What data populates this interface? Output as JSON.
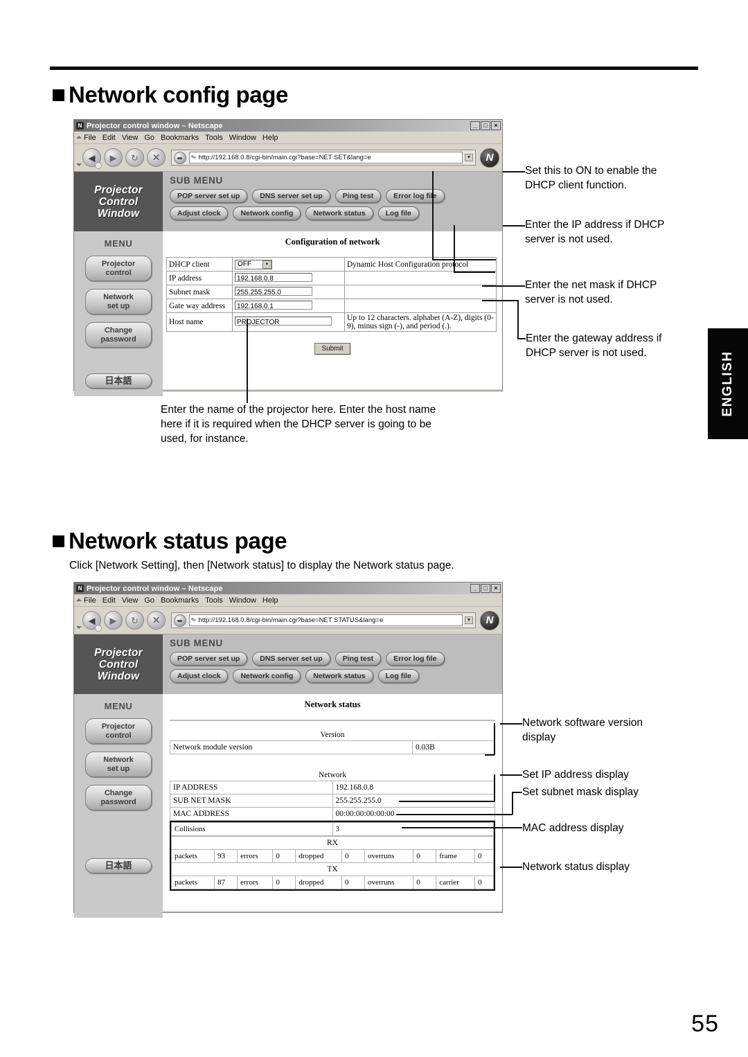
{
  "page": {
    "number": "55",
    "side_tab": "ENGLISH"
  },
  "sections": {
    "config": {
      "heading": "Network config page"
    },
    "status": {
      "heading": "Network status page",
      "intro": "Click [Network Setting], then [Network status] to display the Network status page."
    }
  },
  "browser_chrome": {
    "title": "Projector control window  –  Netscape",
    "title_icon": "netscape-icon",
    "menu_items": [
      "File",
      "Edit",
      "View",
      "Go",
      "Bookmarks",
      "Tools",
      "Window",
      "Help"
    ],
    "window_buttons": [
      "minimize",
      "maximize",
      "close"
    ],
    "nav_buttons": [
      "back",
      "forward",
      "reload",
      "stop"
    ],
    "logo": "N"
  },
  "window_config": {
    "url": "http://192.168.0.8/cgi-bin/main.cgi?base=NET SET&lang=e"
  },
  "window_status": {
    "url": "http://192.168.0.8/cgi-bin/main.cgi?base=NET STATUS&lang=e"
  },
  "app": {
    "brand": [
      "Projector",
      "Control",
      "Window"
    ],
    "menu_label": "MENU",
    "menu_items": [
      {
        "line1": "Projector",
        "line2": "control"
      },
      {
        "line1": "Network",
        "line2": "set up"
      },
      {
        "line1": "Change",
        "line2": "password"
      }
    ],
    "language_button": "日本語",
    "submenu_label": "SUB MENU",
    "submenu_row1": [
      "POP server set up",
      "DNS server set up",
      "Ping test",
      "Error log file"
    ],
    "submenu_row2": [
      "Adjust clock",
      "Network config",
      "Network status",
      "Log file"
    ]
  },
  "config_page": {
    "title": "Configuration of network",
    "rows": [
      {
        "label": "DHCP client",
        "control": "select",
        "value": "OFF",
        "note": "Dynamic Host Configuration protocol"
      },
      {
        "label": "IP address",
        "control": "text",
        "value": "192.168.0.8",
        "note": ""
      },
      {
        "label": "Subnet mask",
        "control": "text",
        "value": "255.255.255.0",
        "note": ""
      },
      {
        "label": "Gate way address",
        "control": "text",
        "value": "192.168.0.1",
        "note": ""
      },
      {
        "label": "Host name",
        "control": "text",
        "value": "PROJECTOR",
        "note": "Up to 12 characters. alphabet (A-Z), digits (0-9), minus sign (-), and period (.)."
      }
    ],
    "submit_label": "Submit"
  },
  "status_page": {
    "title": "Network status",
    "version_group": "Version",
    "version_row": {
      "label": "Network module version",
      "value": "0.03B"
    },
    "network_group": "Network",
    "network_rows": [
      {
        "label": "IP ADDRESS",
        "value": "192.168.0.8"
      },
      {
        "label": "SUB NET MASK",
        "value": "255.255.255.0"
      },
      {
        "label": "MAC ADDRESS",
        "value": "00:00:00:00:00:00"
      }
    ],
    "collisions": {
      "label": "Collisions",
      "value": "3"
    },
    "rx": {
      "heading": "RX",
      "fields": [
        {
          "label": "packets",
          "value": "93"
        },
        {
          "label": "errors",
          "value": "0"
        },
        {
          "label": "dropped",
          "value": "0"
        },
        {
          "label": "overruns",
          "value": "0"
        },
        {
          "label": "frame",
          "value": "0"
        }
      ]
    },
    "tx": {
      "heading": "TX",
      "fields": [
        {
          "label": "packets",
          "value": "87"
        },
        {
          "label": "errors",
          "value": "0"
        },
        {
          "label": "dropped",
          "value": "0"
        },
        {
          "label": "overruns",
          "value": "0"
        },
        {
          "label": "carrier",
          "value": "0"
        }
      ]
    }
  },
  "callouts": {
    "config": [
      "Set this to ON to enable the\nDHCP client function.",
      "Enter the IP address if DHCP\nserver is not used.",
      "Enter the net mask if DHCP\nserver is not used.",
      "Enter the gateway address if\nDHCP server is not used.",
      "Enter the name of the projector here. Enter the host name\nhere if it is required when the DHCP server is going to be\nused, for instance."
    ],
    "status": [
      "Network software version\ndisplay",
      "Set IP address display",
      "Set subnet mask display",
      "MAC address display",
      "Network status display"
    ]
  }
}
